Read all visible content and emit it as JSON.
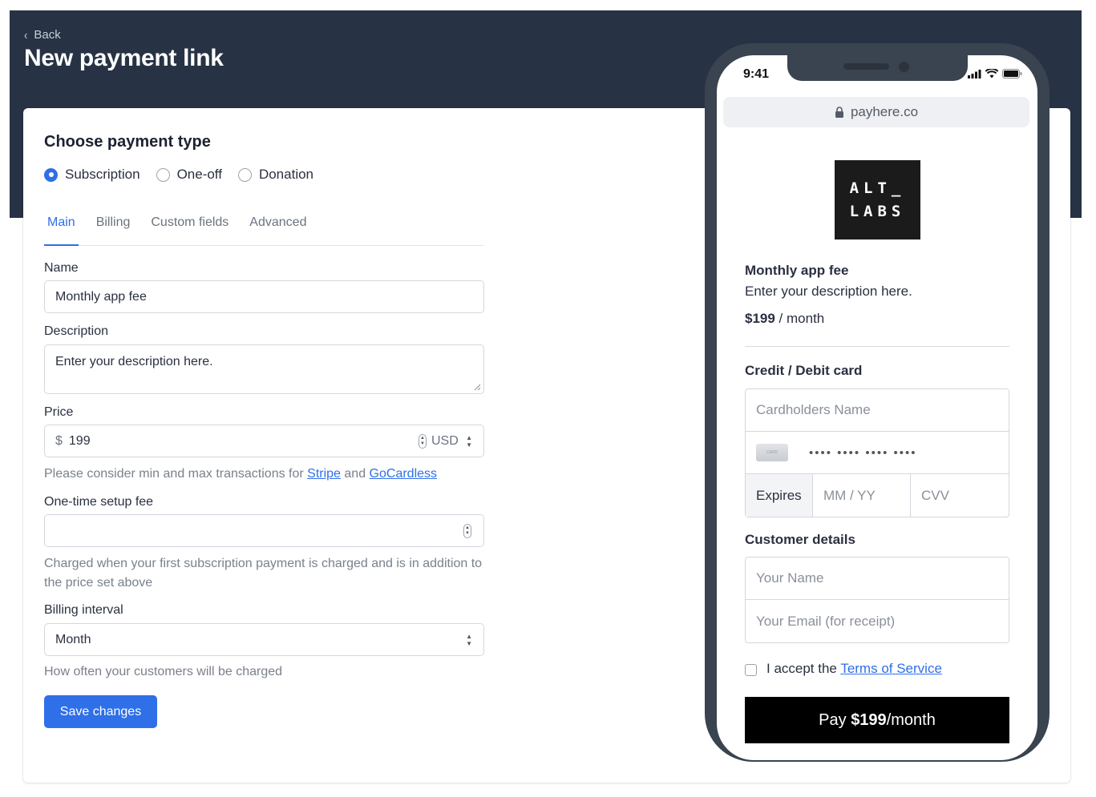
{
  "header": {
    "back_label": "Back",
    "title": "New payment link"
  },
  "form": {
    "section_title": "Choose payment type",
    "payment_types": [
      {
        "label": "Subscription",
        "selected": true
      },
      {
        "label": "One-off",
        "selected": false
      },
      {
        "label": "Donation",
        "selected": false
      }
    ],
    "tabs": [
      {
        "label": "Main",
        "active": true
      },
      {
        "label": "Billing",
        "active": false
      },
      {
        "label": "Custom fields",
        "active": false
      },
      {
        "label": "Advanced",
        "active": false
      }
    ],
    "name": {
      "label": "Name",
      "value": "Monthly app fee"
    },
    "description": {
      "label": "Description",
      "value": "Enter your description here."
    },
    "price": {
      "label": "Price",
      "currency_symbol": "$",
      "value": "199",
      "currency": "USD",
      "help_prefix": "Please consider min and max transactions for ",
      "help_link1": "Stripe",
      "help_mid": " and ",
      "help_link2": "GoCardless"
    },
    "setup_fee": {
      "label": "One-time setup fee",
      "value": "",
      "help": "Charged when your first subscription payment is charged and is in addition to the price set above"
    },
    "billing_interval": {
      "label": "Billing interval",
      "value": "Month",
      "help": "How often your customers will be charged"
    },
    "save_label": "Save changes"
  },
  "preview": {
    "time": "9:41",
    "url": "payhere.co",
    "logo_line1": "ALT_",
    "logo_line2": "LABS",
    "product_name": "Monthly app fee",
    "product_description": "Enter your description here.",
    "price": "$199",
    "price_period": " / month",
    "card_section_title": "Credit / Debit card",
    "cardholder_placeholder": "Cardholders Name",
    "card_chip_label": "CARD",
    "card_number_placeholder": "•••• •••• •••• ••••",
    "expires_label": "Expires",
    "expiry_placeholder": "MM / YY",
    "cvv_placeholder": "CVV",
    "customer_section_title": "Customer details",
    "name_placeholder": "Your Name",
    "email_placeholder": "Your Email (for receipt)",
    "terms_prefix": "I accept the ",
    "terms_link": "Terms of Service",
    "pay_prefix": "Pay ",
    "pay_amount": "$199",
    "pay_suffix": "/month"
  },
  "colors": {
    "header_bg": "#273244",
    "accent": "#2f6fe8",
    "phone_frame": "#3a4350",
    "pay_button": "#000000"
  }
}
